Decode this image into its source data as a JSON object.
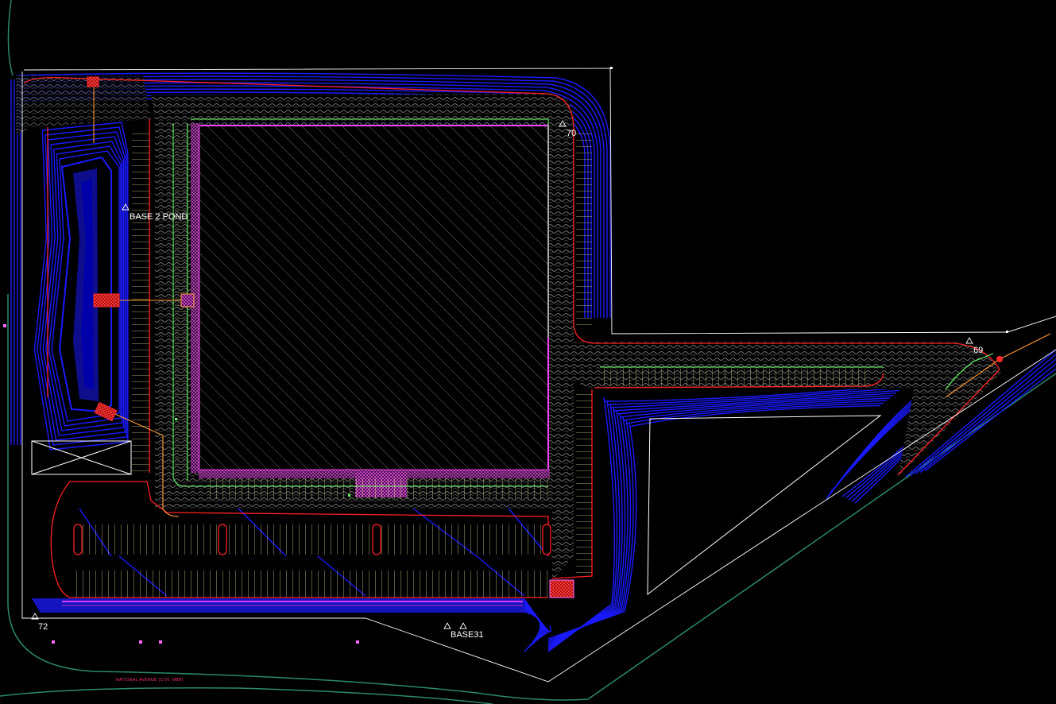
{
  "colors": {
    "background": "#000000",
    "contour": "#1a1aff",
    "curb": "#ff2020",
    "building_outline": "#ff40ff",
    "green_line": "#66ff66",
    "property_line": "#ffffff",
    "hatch": "#6a6a6a",
    "road": "#2a8a6a",
    "yellow_stall": "#d8d890",
    "orange_pipe": "#ff9933",
    "structure": "#ff2a2a",
    "street_text": "#ff3366"
  },
  "labels": {
    "base2_pond": "BASE 2 POND",
    "point_70": "70",
    "point_69": "69",
    "point_72": "72",
    "base31": "BASE31",
    "street": "NATIONAL AVENUE (CTH. MBB)"
  }
}
